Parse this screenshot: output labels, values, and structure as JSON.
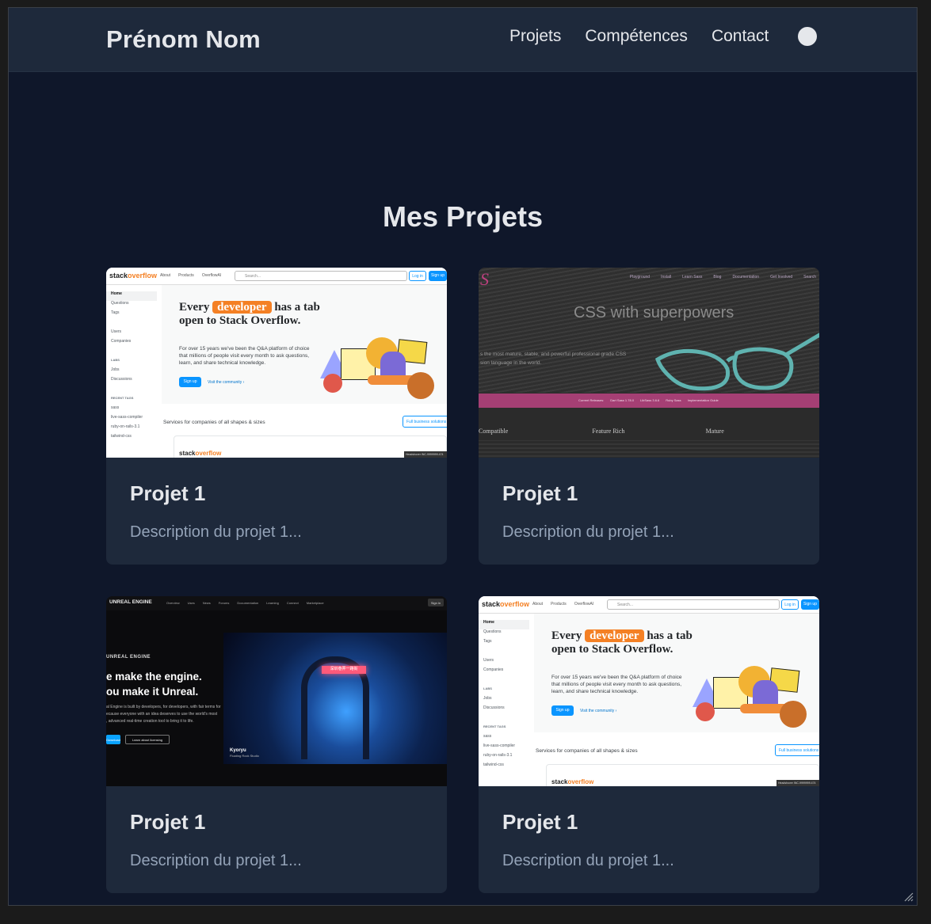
{
  "header": {
    "brand": "Prénom Nom",
    "nav": [
      "Projets",
      "Compétences",
      "Contact"
    ]
  },
  "section": {
    "title": "Mes Projets"
  },
  "projects": [
    {
      "title": "Projet 1",
      "description": "Description du projet 1...",
      "thumbnail": "stackoverflow"
    },
    {
      "title": "Projet 1",
      "description": "Description du projet 1...",
      "thumbnail": "sass"
    },
    {
      "title": "Projet 1",
      "description": "Description du projet 1...",
      "thumbnail": "unreal"
    },
    {
      "title": "Projet 1",
      "description": "Description du projet 1...",
      "thumbnail": "stackoverflow"
    }
  ],
  "thumb_stackoverflow": {
    "logo_prefix": "stack",
    "logo_suffix": "overflow",
    "top_links": [
      "About",
      "Products",
      "OverflowAI"
    ],
    "search_placeholder": "Search...",
    "login": "Log in",
    "signup": "Sign up",
    "sidebar": [
      "Home",
      "Questions",
      "Tags",
      "",
      "Users",
      "Companies",
      "",
      "LABS",
      "Jobs",
      "Discussions",
      "",
      "RECENT TAGS",
      "sass",
      "live-sass-compiler",
      "ruby-on-rails-3.1",
      "tailwind-css"
    ],
    "headline_pre": "Every",
    "headline_pill": "developer",
    "headline_post": "has a tab open to Stack Overflow.",
    "paragraph": "For over 15 years we've been the Q&A platform of choice that millions of people visit every month to ask questions, learn, and share technical knowledge.",
    "cta": "Sign up",
    "cta_link": "Visit the community ›",
    "services": "Services for companies of all shapes & sizes",
    "business": "Full business solutions",
    "badge": "Headshover INC-9999999.474"
  },
  "thumb_sass": {
    "nav": [
      "Playground",
      "Install",
      "Learn Sass",
      "Blog",
      "Documentation",
      "Get Involved",
      "Search"
    ],
    "tagline": "CSS with superpowers",
    "subtitle": "s the most mature, stable, and powerful professional grade CSS\nsion language in the world.",
    "band": [
      "Current Releases:",
      "Dart Sass 1.78.0",
      "LibSass 3.6.6",
      "Ruby Sass",
      "Implementation Guide"
    ],
    "columns": [
      "Compatible",
      "Feature Rich",
      "Mature"
    ]
  },
  "thumb_unreal": {
    "logo": "UNREAL ENGINE",
    "top_links": [
      "Overview",
      "Uses",
      "News",
      "Forums",
      "Documentation",
      "Learning",
      "Connect",
      "Marketplace"
    ],
    "signin": "Sign in",
    "eyebrow": "UNREAL ENGINE",
    "headline": "e make the engine.\nou make it Unreal.",
    "body": "al Engine is built by developers, for developers, with fair terms for\necause everyone with an idea deserves to use the world's most\n, advanced real-time creation tool to bring it to life.",
    "btn_primary": "Download",
    "btn_secondary": "Learn about licensing",
    "neon_sign": "深圳巷弄一路街",
    "caption_title": "Kyoryu",
    "caption_sub": "Floating Rock Studio"
  }
}
